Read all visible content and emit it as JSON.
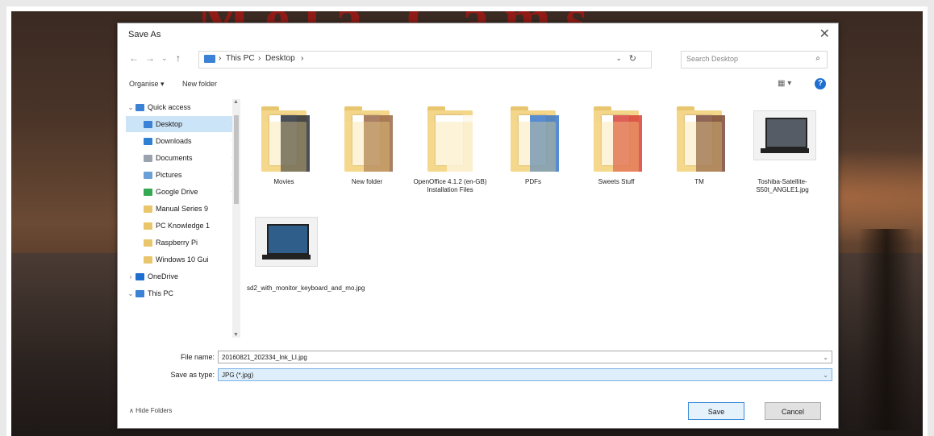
{
  "background": {
    "title_text": "Mela Cams"
  },
  "dialog": {
    "title": "Save As",
    "close_glyph": "✕",
    "nav": {
      "back": "←",
      "forward": "→",
      "recent": "⌄",
      "up": "↑"
    },
    "address": {
      "crumbs": [
        "This PC",
        "Desktop"
      ],
      "separator": "›",
      "dropdown": "⌄",
      "refresh": "↻"
    },
    "search": {
      "placeholder": "Search Desktop",
      "icon": "search-icon"
    },
    "commands": {
      "organize": "Organise ▾",
      "new_folder": "New folder",
      "view": "▦ ▾",
      "help": "?"
    },
    "nav_pane": {
      "items": [
        {
          "label": "Quick access",
          "icon": "star-icon",
          "color": "#3b82d6",
          "chevron": "⌄",
          "pinned": false,
          "selected": false,
          "indent": 0
        },
        {
          "label": "Desktop",
          "icon": "desktop-icon",
          "color": "#3b82d6",
          "chevron": "",
          "pinned": true,
          "selected": true,
          "indent": 1
        },
        {
          "label": "Downloads",
          "icon": "download-icon",
          "color": "#2f7fd2",
          "chevron": "",
          "pinned": true,
          "selected": false,
          "indent": 1
        },
        {
          "label": "Documents",
          "icon": "document-icon",
          "color": "#9aa3ad",
          "chevron": "",
          "pinned": true,
          "selected": false,
          "indent": 1
        },
        {
          "label": "Pictures",
          "icon": "pictures-icon",
          "color": "#6aa0d6",
          "chevron": "",
          "pinned": true,
          "selected": false,
          "indent": 1
        },
        {
          "label": "Google Drive",
          "icon": "google-drive-icon",
          "color": "#34a853",
          "chevron": "",
          "pinned": true,
          "selected": false,
          "indent": 1
        },
        {
          "label": "Manual Series 9",
          "icon": "folder-icon",
          "color": "#e9c66b",
          "chevron": "",
          "pinned": false,
          "selected": false,
          "indent": 1
        },
        {
          "label": "PC Knowledge 1",
          "icon": "folder-icon",
          "color": "#e9c66b",
          "chevron": "",
          "pinned": false,
          "selected": false,
          "indent": 1
        },
        {
          "label": "Raspberry Pi",
          "icon": "folder-icon",
          "color": "#e9c66b",
          "chevron": "",
          "pinned": false,
          "selected": false,
          "indent": 1
        },
        {
          "label": "Windows 10 Gui",
          "icon": "folder-icon",
          "color": "#e9c66b",
          "chevron": "",
          "pinned": false,
          "selected": false,
          "indent": 1
        },
        {
          "label": "OneDrive",
          "icon": "cloud-icon",
          "color": "#1f6fd1",
          "chevron": "›",
          "pinned": false,
          "selected": false,
          "indent": 0
        },
        {
          "label": "This PC",
          "icon": "computer-icon",
          "color": "#3b82d6",
          "chevron": "⌄",
          "pinned": false,
          "selected": false,
          "indent": 0
        }
      ]
    },
    "files": [
      {
        "label": "Movies",
        "kind": "folder",
        "art": "#2a2f38"
      },
      {
        "label": "New folder",
        "kind": "folder",
        "art": "#9b6a4a"
      },
      {
        "label": "OpenOffice 4.1.2 (en-GB) Installation Files",
        "kind": "folder",
        "art": "#ffffff"
      },
      {
        "label": "PDFs",
        "kind": "folder",
        "art": "#3a78c9"
      },
      {
        "label": "Sweets Stuff",
        "kind": "folder",
        "art": "#d8433a"
      },
      {
        "label": "TM",
        "kind": "folder",
        "art": "#7a4a38"
      },
      {
        "label": "Toshiba-Satellite-S50t_ANGLE1.jpg",
        "kind": "image",
        "art": "#555c66"
      },
      {
        "label": "sd2_with_monitor_keyboard_and_mo.jpg",
        "kind": "image",
        "art": "#2f5e8a"
      }
    ],
    "form": {
      "file_name_label": "File name:",
      "file_name_value": "20160821_202334_Ink_LI.jpg",
      "save_type_label": "Save as type:",
      "save_type_value": "JPG (*.jpg)"
    },
    "footer": {
      "hide_folders": "Hide Folders",
      "save": "Save",
      "cancel": "Cancel"
    }
  }
}
